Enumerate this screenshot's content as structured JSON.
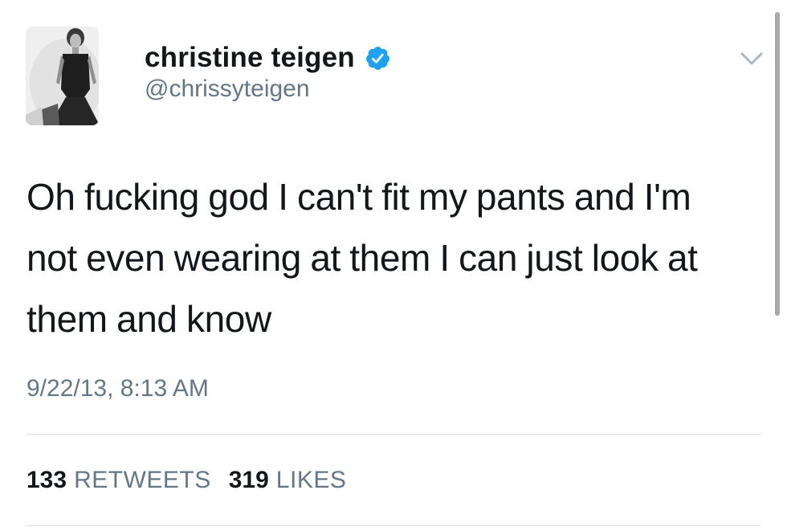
{
  "tweet": {
    "author": {
      "display_name": "christine teigen",
      "handle": "@chrissyteigen",
      "verified": true
    },
    "text_lines": [
      "Oh fucking god I can't fit my pants and I'm",
      "not even wearing at them I can just look at",
      "them and know"
    ],
    "timestamp": "9/22/13, 8:13 AM",
    "stats": {
      "retweets_count": "133",
      "retweets_label": "RETWEETS",
      "likes_count": "319",
      "likes_label": "LIKES"
    }
  },
  "icons": {
    "verified": "verified-badge-icon",
    "menu": "chevron-down-icon"
  },
  "colors": {
    "text_primary": "#14171a",
    "text_secondary": "#657786",
    "verified_blue": "#1da1f2",
    "divider": "#d9dde1"
  }
}
